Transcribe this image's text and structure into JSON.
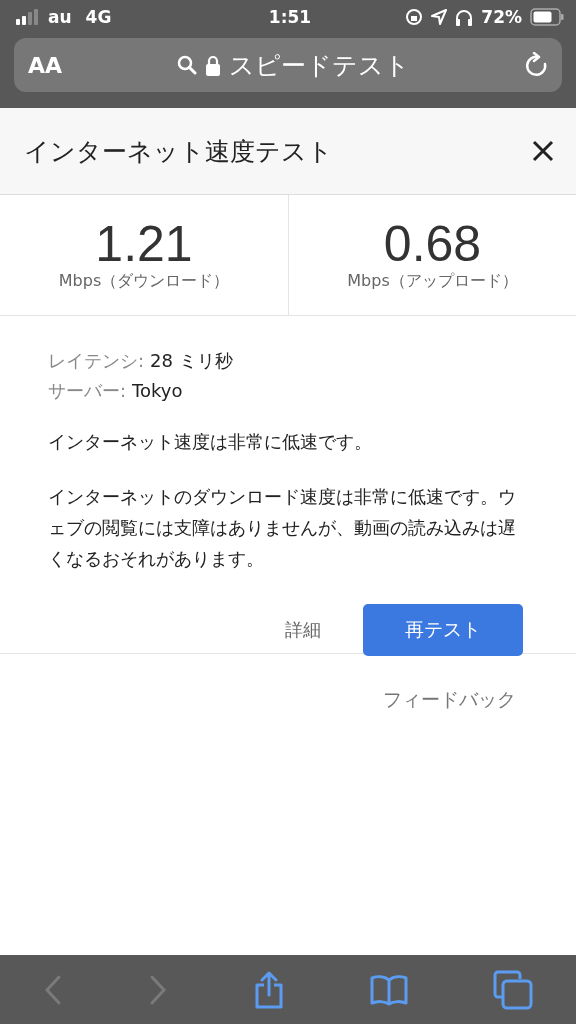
{
  "status_bar": {
    "carrier": "au",
    "network": "4G",
    "time": "1:51",
    "battery": "72%"
  },
  "address_bar": {
    "text_size": "AA",
    "title": "スピードテスト"
  },
  "dialog": {
    "title": "インターネット速度テスト",
    "metrics": [
      {
        "value": "1.21",
        "unit": "Mbps（ダウンロード）"
      },
      {
        "value": "0.68",
        "unit": "Mbps（アップロード）"
      }
    ],
    "details": [
      {
        "label": "レイテンシ:",
        "value": "28 ミリ秒"
      },
      {
        "label": "サーバー:",
        "value": "Tokyo"
      }
    ],
    "summary": "インターネット速度は非常に低速です。",
    "description": "インターネットのダウンロード速度は非常に低速です。ウェブの閲覧には支障はありませんが、動画の読み込みは遅くなるおそれがあります。",
    "details_link": "詳細",
    "retest_button": "再テスト",
    "feedback": "フィードバック"
  },
  "toolbar": {
    "back_disabled": true,
    "forward_disabled": true
  }
}
